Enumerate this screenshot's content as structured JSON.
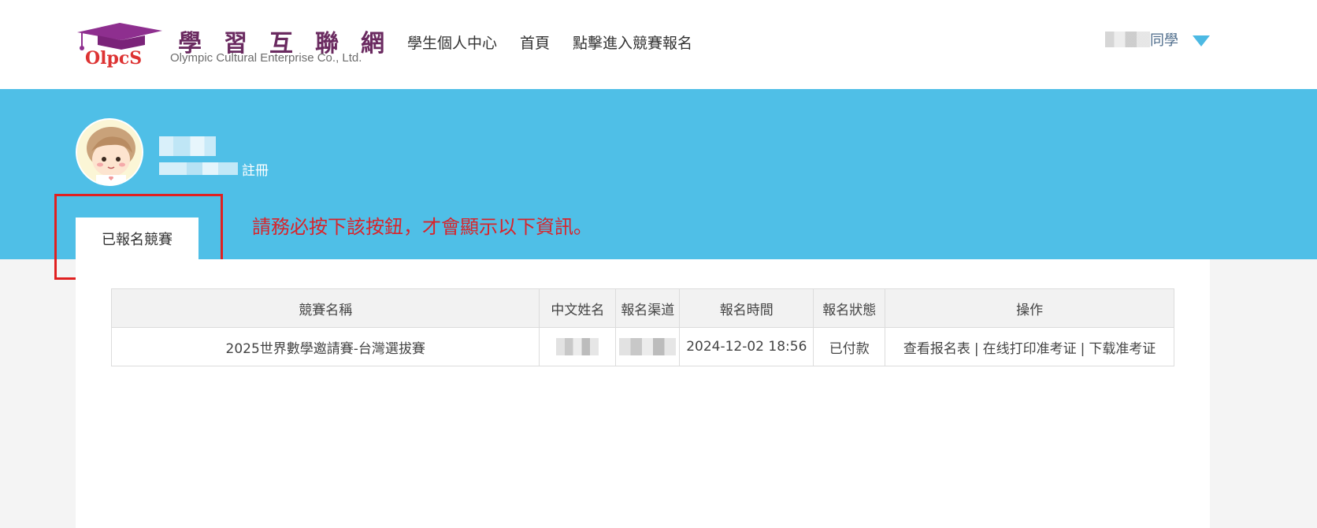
{
  "header": {
    "brand_cn": "學習互聯網",
    "brand_en": "Olympic Cultural Enterprise Co., Ltd.",
    "logo_text": "OlpcS",
    "nav": [
      "學生個人中心",
      "首頁",
      "點擊進入競賽報名"
    ],
    "user_suffix": "同學"
  },
  "profile": {
    "sub_label": "註冊"
  },
  "tabs": {
    "active_label": "已報名競賽"
  },
  "notice": "請務必按下該按鈕，才會顯示以下資訊。",
  "table": {
    "headers": [
      "競賽名稱",
      "中文姓名",
      "報名渠道",
      "報名時間",
      "報名狀態",
      "操作"
    ],
    "rows": [
      {
        "name": "2025世界數學邀請賽-台灣選拔賽",
        "time": "2024-12-02 18:56",
        "status": "已付款",
        "actions": [
          "查看报名表",
          "在线打印准考证",
          "下载准考证"
        ]
      }
    ]
  },
  "colors": {
    "banner": "#4fbfe7",
    "notice": "#d9232a",
    "highlight": "#e02020",
    "brand": "#6a2a60"
  }
}
